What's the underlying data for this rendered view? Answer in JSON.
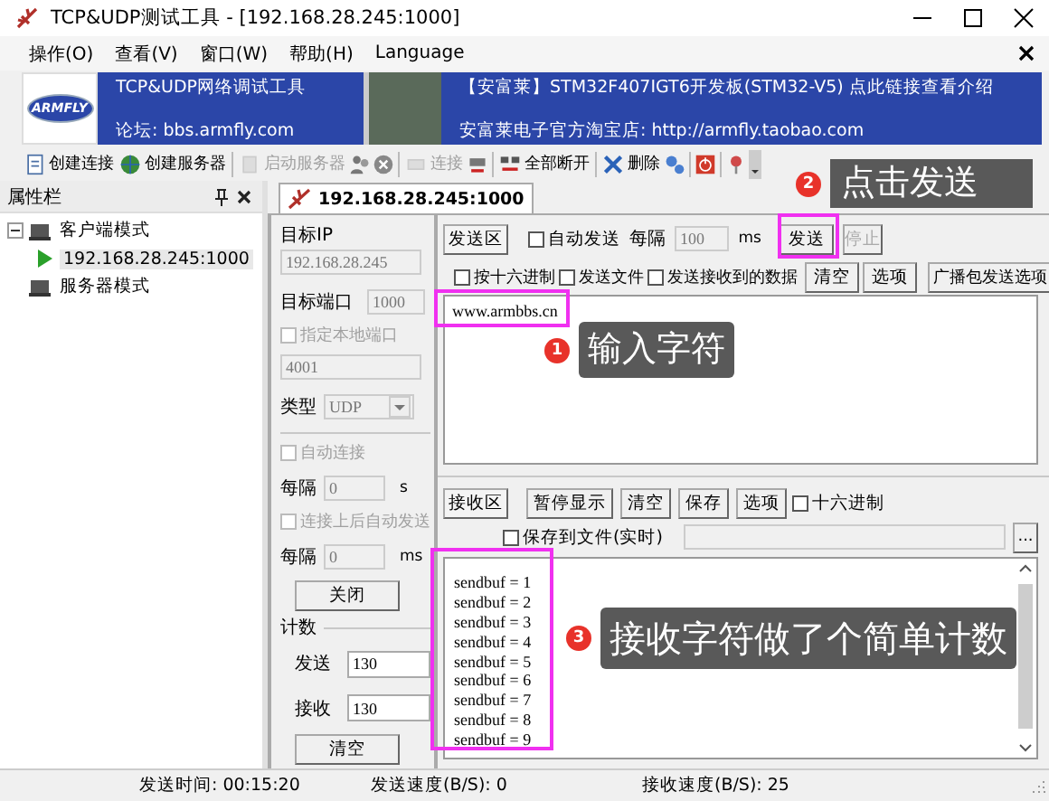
{
  "window": {
    "title": "TCP&UDP测试工具 - [192.168.28.245:1000]"
  },
  "menu": [
    {
      "label": "操作(O)"
    },
    {
      "label": "查看(V)"
    },
    {
      "label": "窗口(W)"
    },
    {
      "label": "帮助(H)"
    },
    {
      "label": "Language"
    }
  ],
  "banner": {
    "logo": "ARMFLY",
    "title": "TCP&UDP网络调试工具",
    "forum": "论坛: bbs.armfly.com",
    "headline": "【安富莱】STM32F407IGT6开发板(STM32-V5) 点此链接查看介绍",
    "shop": "安富莱电子官方淘宝店: http://armfly.taobao.com"
  },
  "toolbar": [
    {
      "kind": "button",
      "label": "创建连接",
      "disabled": false
    },
    {
      "kind": "button",
      "label": "创建服务器",
      "disabled": false
    },
    {
      "kind": "separator"
    },
    {
      "kind": "button",
      "label": "启动服务器",
      "disabled": true
    },
    {
      "kind": "icon",
      "disabled": false
    },
    {
      "kind": "icon",
      "disabled": false
    },
    {
      "kind": "separator"
    },
    {
      "kind": "button",
      "label": "连接",
      "disabled": true
    },
    {
      "kind": "icon",
      "disabled": false
    },
    {
      "kind": "separator"
    },
    {
      "kind": "button",
      "label": "全部断开",
      "disabled": false
    },
    {
      "kind": "separator"
    },
    {
      "kind": "button",
      "label": "删除",
      "disabled": false
    },
    {
      "kind": "icon",
      "disabled": false
    },
    {
      "kind": "separator"
    },
    {
      "kind": "icon",
      "disabled": false
    },
    {
      "kind": "separator"
    },
    {
      "kind": "icon",
      "disabled": false
    }
  ],
  "sidebar": {
    "title": "属性栏",
    "tree": [
      {
        "label": "客户端模式",
        "expanded": true,
        "children": [
          {
            "label": "192.168.28.245:1000",
            "selected": true
          }
        ]
      },
      {
        "label": "服务器模式"
      }
    ]
  },
  "tabs": [
    {
      "label": "192.168.28.245:1000",
      "selected": true
    }
  ],
  "settings": {
    "target_ip_label": "目标IP",
    "target_ip": "192.168.28.245",
    "target_port_label": "目标端口",
    "target_port": "1000",
    "local_port": {
      "label": "指定本地端口",
      "checked": false,
      "disabled": true
    },
    "local_port_value": "4001",
    "type_label": "类型",
    "type_value": "UDP",
    "auto_connect": {
      "label": "自动连接",
      "checked": false,
      "disabled": true
    },
    "interval_label": "每隔",
    "interval_value": "0",
    "interval_unit": "s",
    "auto_send": {
      "label": "连接上后自动发送",
      "checked": false,
      "disabled": true
    },
    "send_interval_label": "每隔",
    "send_interval_value": "0",
    "send_interval_unit": "ms",
    "close_button": "关闭",
    "count_label": "计数",
    "sent_label": "发送",
    "sent_value": "130",
    "received_label": "接收",
    "received_value": "130",
    "clear_button": "清空"
  },
  "send": {
    "area_label": "发送区",
    "auto_send": {
      "label": "自动发送",
      "checked": false,
      "disabled": false
    },
    "interval_label": "每隔",
    "interval_value": "100",
    "interval_unit": "ms",
    "send_button": "发送",
    "stop_button": {
      "label": "停止",
      "disabled": true
    },
    "options": [
      {
        "label": "按十六进制",
        "checked": false,
        "disabled": false
      },
      {
        "label": "发送文件",
        "checked": false,
        "disabled": false
      },
      {
        "label": "发送接收到的数据",
        "checked": false,
        "disabled": false
      }
    ],
    "clear_button": "清空",
    "options_button": "选项",
    "broadcast_button": "广播包发送选项",
    "text": "www.armbbs.cn"
  },
  "receive": {
    "area_label": "接收区",
    "buttons": [
      "暂停显示",
      "清空",
      "保存",
      "选项"
    ],
    "hex": {
      "label": "十六进制",
      "checked": false,
      "disabled": false
    },
    "save_to_file": {
      "label": "保存到文件(实时)",
      "checked": false,
      "disabled": false
    },
    "browse_button": "...",
    "lines": [
      "sendbuf = 1",
      "sendbuf = 2",
      "sendbuf = 3",
      "sendbuf = 4",
      "sendbuf = 5",
      "sendbuf = 6",
      "sendbuf = 7",
      "sendbuf = 8",
      "sendbuf = 9"
    ]
  },
  "status_bar": [
    "发送时间: 00:15:20",
    "发送速度(B/S): 0",
    "接收速度(B/S): 25"
  ],
  "annotations": [
    {
      "number": "1",
      "text": "输入字符"
    },
    {
      "number": "2",
      "text": "点击发送"
    },
    {
      "number": "3",
      "text": "接收字符做了个简单计数"
    }
  ]
}
